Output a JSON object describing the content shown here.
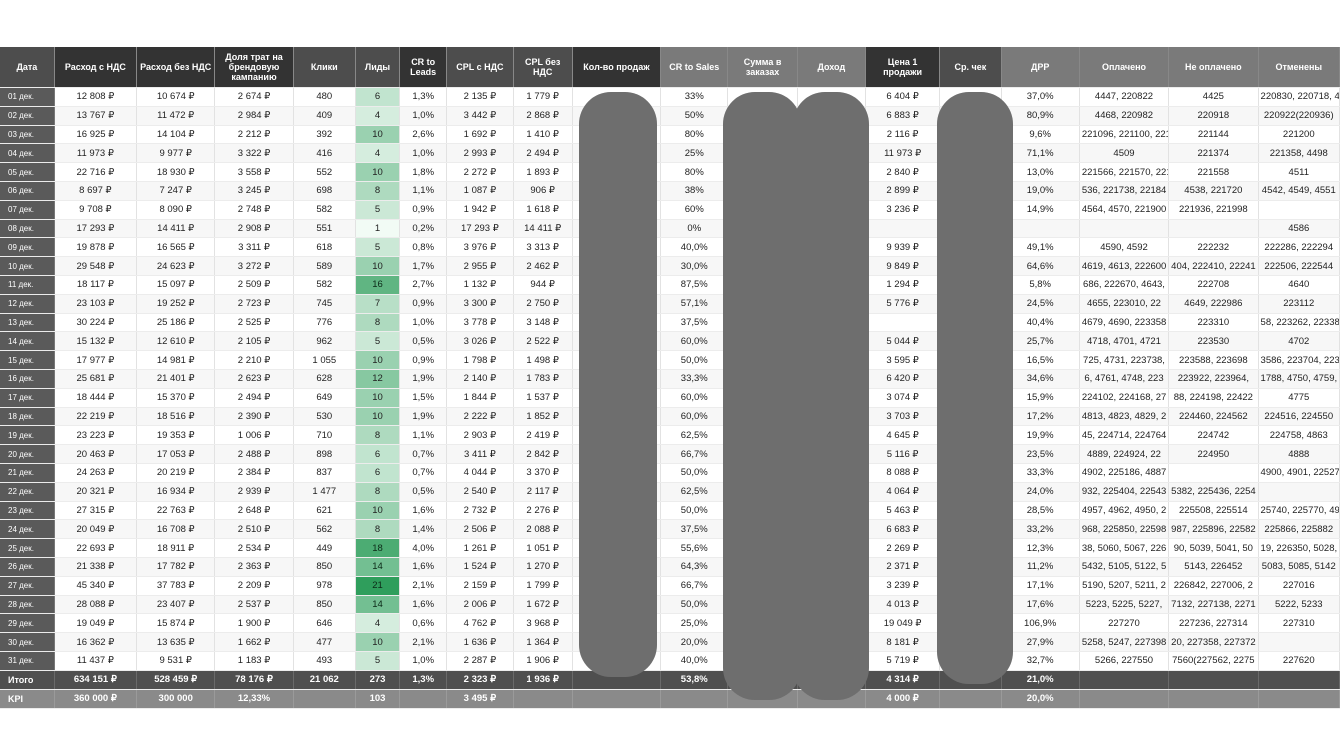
{
  "headers": [
    "Дата",
    "Расход с НДС",
    "Расход без НДС",
    "Доля трат на брендовую кампанию",
    "Клики",
    "Лиды",
    "CR to Leads",
    "CPL с НДС",
    "CPL без НДС",
    "Кол-во продаж",
    "CR to Sales",
    "Сумма в заказах",
    "Доход",
    "Цена 1 продажи",
    "Ср. чек",
    "ДРР",
    "Оплачено",
    "Не оплачено",
    "Отменены"
  ],
  "rows": [
    [
      "01 дек.",
      "12 808 ₽",
      "10 674 ₽",
      "2 674 ₽",
      "480",
      "6",
      "1,3%",
      "2 135 ₽",
      "1 779 ₽",
      "",
      "33%",
      "",
      "",
      "6 404 ₽",
      "",
      "37,0%",
      "4447, 220822",
      "4425",
      "220830, 220718, 44"
    ],
    [
      "02 дек.",
      "13 767 ₽",
      "11 472 ₽",
      "2 984 ₽",
      "409",
      "4",
      "1,0%",
      "3 442 ₽",
      "2 868 ₽",
      "",
      "50%",
      "",
      "",
      "6 883 ₽",
      "",
      "80,9%",
      "4468, 220982",
      "220918",
      "220922(220936)"
    ],
    [
      "03 дек.",
      "16 925 ₽",
      "14 104 ₽",
      "2 212 ₽",
      "392",
      "10",
      "2,6%",
      "1 692 ₽",
      "1 410 ₽",
      "",
      "80%",
      "",
      "",
      "2 116 ₽",
      "",
      "9,6%",
      "221096, 221100, 221",
      "221144",
      "221200"
    ],
    [
      "04 дек.",
      "11 973 ₽",
      "9 977 ₽",
      "3 322 ₽",
      "416",
      "4",
      "1,0%",
      "2 993 ₽",
      "2 494 ₽",
      "",
      "25%",
      "",
      "",
      "11 973 ₽",
      "",
      "71,1%",
      "4509",
      "221374",
      "221358, 4498"
    ],
    [
      "05 дек.",
      "22 716 ₽",
      "18 930 ₽",
      "3 558 ₽",
      "552",
      "10",
      "1,8%",
      "2 272 ₽",
      "1 893 ₽",
      "",
      "80%",
      "",
      "",
      "2 840 ₽",
      "",
      "13,0%",
      "221566, 221570, 2215",
      "221558",
      "4511"
    ],
    [
      "06 дек.",
      "8 697 ₽",
      "7 247 ₽",
      "3 245 ₽",
      "698",
      "8",
      "1,1%",
      "1 087 ₽",
      "906 ₽",
      "",
      "38%",
      "",
      "",
      "2 899 ₽",
      "",
      "19,0%",
      "536, 221738, 22184",
      "4538, 221720",
      "4542, 4549, 4551"
    ],
    [
      "07 дек.",
      "9 708 ₽",
      "8 090 ₽",
      "2 748 ₽",
      "582",
      "5",
      "0,9%",
      "1 942 ₽",
      "1 618 ₽",
      "",
      "60%",
      "",
      "",
      "3 236 ₽",
      "",
      "14,9%",
      "4564, 4570, 221900",
      "221936, 221998",
      ""
    ],
    [
      "08 дек.",
      "17 293 ₽",
      "14 411 ₽",
      "2 908 ₽",
      "551",
      "1",
      "0,2%",
      "17 293 ₽",
      "14 411 ₽",
      "",
      "0%",
      "",
      "",
      "",
      "",
      "",
      "",
      "",
      "4586"
    ],
    [
      "09 дек.",
      "19 878 ₽",
      "16 565 ₽",
      "3 311 ₽",
      "618",
      "5",
      "0,8%",
      "3 976 ₽",
      "3 313 ₽",
      "",
      "40,0%",
      "",
      "",
      "9 939 ₽",
      "",
      "49,1%",
      "4590, 4592",
      "222232",
      "222286, 222294"
    ],
    [
      "10 дек.",
      "29 548 ₽",
      "24 623 ₽",
      "3 272 ₽",
      "589",
      "10",
      "1,7%",
      "2 955 ₽",
      "2 462 ₽",
      "",
      "30,0%",
      "",
      "",
      "9 849 ₽",
      "",
      "64,6%",
      "4619, 4613, 222600",
      "404, 222410, 22241",
      "222506, 222544"
    ],
    [
      "11 дек.",
      "18 117 ₽",
      "15 097 ₽",
      "2 509 ₽",
      "582",
      "16",
      "2,7%",
      "1 132 ₽",
      "944 ₽",
      "",
      "87,5%",
      "",
      "",
      "1 294 ₽",
      "",
      "5,8%",
      "686, 222670, 4643,",
      "222708",
      "4640"
    ],
    [
      "12 дек.",
      "23 103 ₽",
      "19 252 ₽",
      "2 723 ₽",
      "745",
      "7",
      "0,9%",
      "3 300 ₽",
      "2 750 ₽",
      "",
      "57,1%",
      "",
      "",
      "5 776 ₽",
      "",
      "24,5%",
      "4655, 223010, 22",
      "4649, 222986",
      "223112"
    ],
    [
      "13 дек.",
      "30 224 ₽",
      "25 186 ₽",
      "2 525 ₽",
      "776",
      "8",
      "1,0%",
      "3 778 ₽",
      "3 148 ₽",
      "",
      "37,5%",
      "",
      "",
      "",
      "",
      "40,4%",
      "4679, 4690, 223358",
      "223310",
      "58, 223262, 22338"
    ],
    [
      "14 дек.",
      "15 132 ₽",
      "12 610 ₽",
      "2 105 ₽",
      "962",
      "5",
      "0,5%",
      "3 026 ₽",
      "2 522 ₽",
      "",
      "60,0%",
      "",
      "",
      "5 044 ₽",
      "",
      "25,7%",
      "4718, 4701, 4721",
      "223530",
      "4702"
    ],
    [
      "15 дек.",
      "17 977 ₽",
      "14 981 ₽",
      "2 210 ₽",
      "1 055",
      "10",
      "0,9%",
      "1 798 ₽",
      "1 498 ₽",
      "",
      "50,0%",
      "",
      "",
      "3 595 ₽",
      "",
      "16,5%",
      "725, 4731, 223738,",
      "223588, 223698",
      "3586, 223704, 223"
    ],
    [
      "16 дек.",
      "25 681 ₽",
      "21 401 ₽",
      "2 623 ₽",
      "628",
      "12",
      "1,9%",
      "2 140 ₽",
      "1 783 ₽",
      "",
      "33,3%",
      "",
      "",
      "6 420 ₽",
      "",
      "34,6%",
      "6, 4761, 4748, 223",
      "223922, 223964,",
      "1788, 4750, 4759, 4"
    ],
    [
      "17 дек.",
      "18 444 ₽",
      "15 370 ₽",
      "2 494 ₽",
      "649",
      "10",
      "1,5%",
      "1 844 ₽",
      "1 537 ₽",
      "",
      "60,0%",
      "",
      "",
      "3 074 ₽",
      "",
      "15,9%",
      "224102, 224168, 27",
      "88, 224198, 22422",
      "4775"
    ],
    [
      "18 дек.",
      "22 219 ₽",
      "18 516 ₽",
      "2 390 ₽",
      "530",
      "10",
      "1,9%",
      "2 222 ₽",
      "1 852 ₽",
      "",
      "60,0%",
      "",
      "",
      "3 703 ₽",
      "",
      "17,2%",
      "4813, 4823, 4829, 2",
      "224460, 224562",
      "224516, 224550"
    ],
    [
      "19 дек.",
      "23 223 ₽",
      "19 353 ₽",
      "1 006 ₽",
      "710",
      "8",
      "1,1%",
      "2 903 ₽",
      "2 419 ₽",
      "",
      "62,5%",
      "",
      "",
      "4 645 ₽",
      "",
      "19,9%",
      "45, 224714, 224764",
      "224742",
      "224758, 4863"
    ],
    [
      "20 дек.",
      "20 463 ₽",
      "17 053 ₽",
      "2 488 ₽",
      "898",
      "6",
      "0,7%",
      "3 411 ₽",
      "2 842 ₽",
      "",
      "66,7%",
      "",
      "",
      "5 116 ₽",
      "",
      "23,5%",
      "4889, 224924, 22",
      "224950",
      "4888"
    ],
    [
      "21 дек.",
      "24 263 ₽",
      "20 219 ₽",
      "2 384 ₽",
      "837",
      "6",
      "0,7%",
      "4 044 ₽",
      "3 370 ₽",
      "",
      "50,0%",
      "",
      "",
      "8 088 ₽",
      "",
      "33,3%",
      "4902, 225186, 4887",
      "",
      "4900, 4901, 22527"
    ],
    [
      "22 дек.",
      "20 321 ₽",
      "16 934 ₽",
      "2 939 ₽",
      "1 477",
      "8",
      "0,5%",
      "2 540 ₽",
      "2 117 ₽",
      "",
      "62,5%",
      "",
      "",
      "4 064 ₽",
      "",
      "24,0%",
      "932, 225404, 22543",
      "5382, 225436, 2254",
      ""
    ],
    [
      "23 дек.",
      "27 315 ₽",
      "22 763 ₽",
      "2 648 ₽",
      "621",
      "10",
      "1,6%",
      "2 732 ₽",
      "2 276 ₽",
      "",
      "50,0%",
      "",
      "",
      "5 463 ₽",
      "",
      "28,5%",
      "4957, 4962, 4950, 2",
      "225508, 225514",
      "25740, 225770, 49"
    ],
    [
      "24 дек.",
      "20 049 ₽",
      "16 708 ₽",
      "2 510 ₽",
      "562",
      "8",
      "1,4%",
      "2 506 ₽",
      "2 088 ₽",
      "",
      "37,5%",
      "",
      "",
      "6 683 ₽",
      "",
      "33,2%",
      "968, 225850, 22598",
      "987, 225896, 22582",
      "225866, 225882"
    ],
    [
      "25 дек.",
      "22 693 ₽",
      "18 911 ₽",
      "2 534 ₽",
      "449",
      "18",
      "4,0%",
      "1 261 ₽",
      "1 051 ₽",
      "",
      "55,6%",
      "",
      "",
      "2 269 ₽",
      "",
      "12,3%",
      "38, 5060, 5067, 226",
      "90, 5039, 5041, 50",
      "19, 226350, 5028, 5"
    ],
    [
      "26 дек.",
      "21 338 ₽",
      "17 782 ₽",
      "2 363 ₽",
      "850",
      "14",
      "1,6%",
      "1 524 ₽",
      "1 270 ₽",
      "",
      "64,3%",
      "",
      "",
      "2 371 ₽",
      "",
      "11,2%",
      "5432, 5105, 5122, 5",
      "5143, 226452",
      "5083, 5085, 5142"
    ],
    [
      "27 дек.",
      "45 340 ₽",
      "37 783 ₽",
      "2 209 ₽",
      "978",
      "21",
      "2,1%",
      "2 159 ₽",
      "1 799 ₽",
      "",
      "66,7%",
      "",
      "",
      "3 239 ₽",
      "",
      "17,1%",
      "5190, 5207, 5211, 2",
      "226842, 227006, 2",
      "227016"
    ],
    [
      "28 дек.",
      "28 088 ₽",
      "23 407 ₽",
      "2 537 ₽",
      "850",
      "14",
      "1,6%",
      "2 006 ₽",
      "1 672 ₽",
      "",
      "50,0%",
      "",
      "",
      "4 013 ₽",
      "",
      "17,6%",
      "5223, 5225, 5227,",
      "7132, 227138, 2271",
      "5222, 5233"
    ],
    [
      "29 дек.",
      "19 049 ₽",
      "15 874 ₽",
      "1 900 ₽",
      "646",
      "4",
      "0,6%",
      "4 762 ₽",
      "3 968 ₽",
      "",
      "25,0%",
      "",
      "",
      "19 049 ₽",
      "",
      "106,9%",
      "227270",
      "227236, 227314",
      "227310"
    ],
    [
      "30 дек.",
      "16 362 ₽",
      "13 635 ₽",
      "1 662 ₽",
      "477",
      "10",
      "2,1%",
      "1 636 ₽",
      "1 364 ₽",
      "",
      "20,0%",
      "",
      "",
      "8 181 ₽",
      "",
      "27,9%",
      "5258, 5247, 227398",
      "20, 227358, 227372",
      ""
    ],
    [
      "31 дек.",
      "11 437 ₽",
      "9 531 ₽",
      "1 183 ₽",
      "493",
      "5",
      "1,0%",
      "2 287 ₽",
      "1 906 ₽",
      "",
      "40,0%",
      "",
      "",
      "5 719 ₽",
      "",
      "32,7%",
      "5266, 227550",
      "7560(227562, 2275",
      "227620"
    ]
  ],
  "total": [
    "Итого",
    "634 151 ₽",
    "528 459 ₽",
    "78 176 ₽",
    "21 062",
    "273",
    "1,3%",
    "2 323 ₽",
    "1 936 ₽",
    "",
    "53,8%",
    "",
    "",
    "4 314 ₽",
    "",
    "21,0%",
    "",
    "",
    ""
  ],
  "kpi": [
    "KPI",
    "360 000 ₽",
    "300 000",
    "12,33%",
    "",
    "103",
    "",
    "3 495 ₽",
    "",
    "",
    "",
    "",
    "",
    "4 000 ₽",
    "",
    "20,0%",
    "",
    "",
    ""
  ],
  "colors": {
    "header_dark": "#333333",
    "header": "#4d4d4d",
    "header_mid": "#7a7a7a",
    "leads_max": "#3aa864",
    "leads_min": "#e7f6ec",
    "redaction": "#6e6e6e"
  }
}
